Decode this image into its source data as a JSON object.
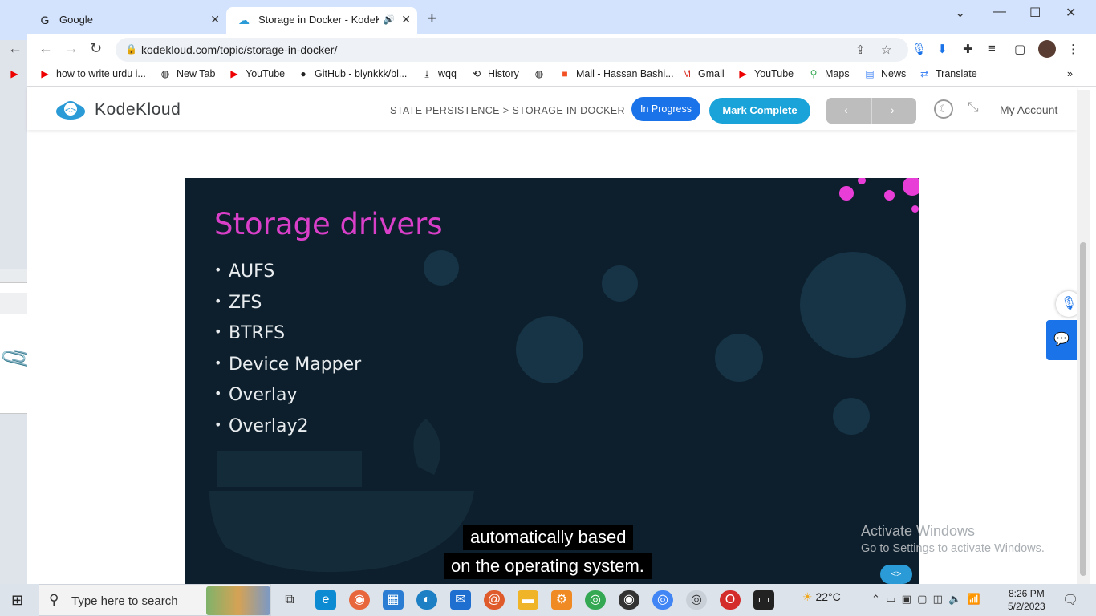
{
  "browser": {
    "tabs": [
      {
        "title": "Google",
        "favicon": "google-icon"
      },
      {
        "title": "Storage in Docker - KodeKloud",
        "favicon": "kodekloud-icon"
      }
    ],
    "url": "kodekloud.com/topic/storage-in-docker/",
    "bookmarks": [
      {
        "label": "how to write urdu i...",
        "icon": "youtube-icon"
      },
      {
        "label": "New Tab",
        "icon": "globe-icon"
      },
      {
        "label": "YouTube",
        "icon": "youtube-icon"
      },
      {
        "label": "GitHub - blynkkk/bl...",
        "icon": "github-icon"
      },
      {
        "label": "wqq",
        "icon": "download-icon"
      },
      {
        "label": "History",
        "icon": "history-icon"
      },
      {
        "label": "Mail - Hassan Bashi...",
        "icon": "microsoft-icon"
      },
      {
        "label": "Gmail",
        "icon": "gmail-icon"
      },
      {
        "label": "YouTube",
        "icon": "youtube-icon"
      },
      {
        "label": "Maps",
        "icon": "maps-icon"
      },
      {
        "label": "News",
        "icon": "news-icon"
      },
      {
        "label": "Translate",
        "icon": "translate-icon"
      }
    ]
  },
  "site": {
    "logo_text": "KodeKloud",
    "breadcrumb": "STATE PERSISTENCE > STORAGE IN DOCKER",
    "in_progress_label": "In Progress",
    "mark_complete_label": "Mark Complete",
    "prev_label": "‹",
    "next_label": "›",
    "account_label": "My Account"
  },
  "video": {
    "slide_title": "Storage drivers",
    "bullets": [
      "AUFS",
      "ZFS",
      "BTRFS",
      "Device Mapper",
      "Overlay",
      "Overlay2"
    ],
    "subtitle_line1": "automatically based",
    "subtitle_line2": "on the operating system."
  },
  "watermark": {
    "line1": "Activate Windows",
    "line2": "Go to Settings to activate Windows."
  },
  "taskbar": {
    "search_placeholder": "Type here to search",
    "temperature": "22°C",
    "time": "8:26 PM",
    "date": "5/2/2023"
  },
  "colors": {
    "accent_blue": "#1a73e8",
    "mark_complete": "#1aa3d9",
    "slide_bg": "#0d1f2c",
    "slide_title": "#d93fc9"
  }
}
